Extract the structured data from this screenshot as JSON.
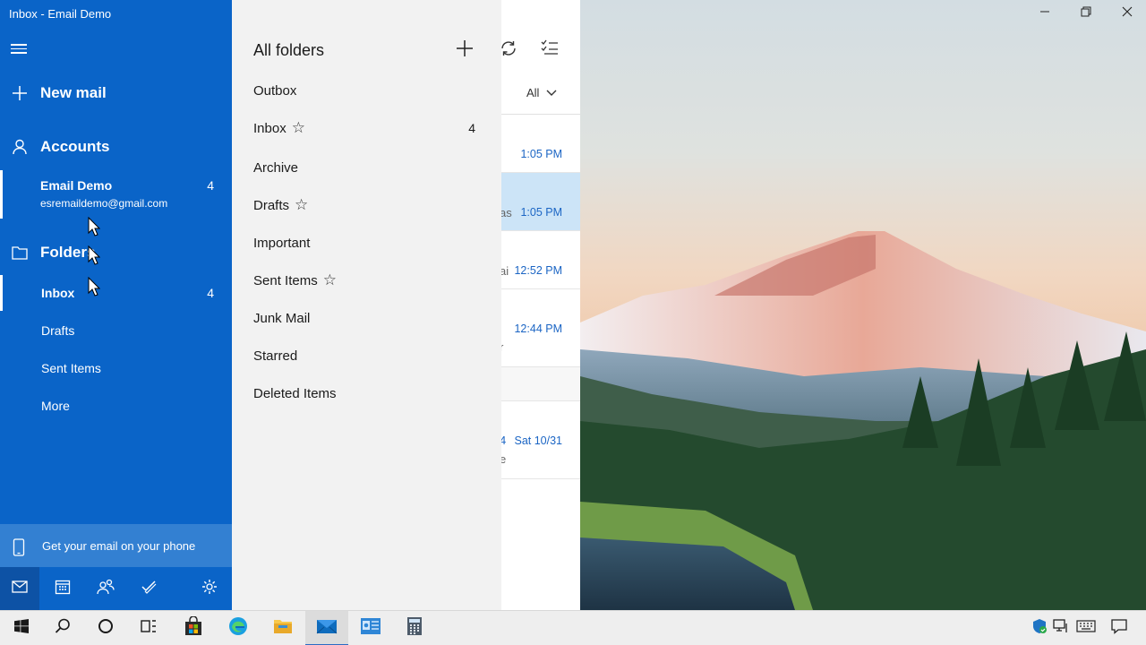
{
  "window": {
    "title": "Inbox - Email Demo"
  },
  "nav": {
    "new_mail": "New mail",
    "accounts": "Accounts",
    "account_name": "Email Demo",
    "account_email": "esremaildemo@gmail.com",
    "account_count": "4",
    "folders": "Folders",
    "items": [
      {
        "label": "Inbox",
        "count": "4"
      },
      {
        "label": "Drafts",
        "count": ""
      },
      {
        "label": "Sent Items",
        "count": ""
      },
      {
        "label": "More",
        "count": ""
      }
    ],
    "phone_promo": "Get your email on your phone",
    "bottom_icons": [
      "mail-icon",
      "calendar-icon",
      "people-icon",
      "todo-icon",
      "settings-icon"
    ]
  },
  "all_folders": {
    "title": "All folders",
    "items": [
      {
        "label": "Outbox",
        "starred": false,
        "count": ""
      },
      {
        "label": "Inbox",
        "starred": true,
        "count": "4"
      },
      {
        "label": "Archive",
        "starred": false,
        "count": ""
      },
      {
        "label": "Drafts",
        "starred": true,
        "count": ""
      },
      {
        "label": "Important",
        "starred": false,
        "count": ""
      },
      {
        "label": "Sent Items",
        "starred": true,
        "count": ""
      },
      {
        "label": "Junk Mail",
        "starred": false,
        "count": ""
      },
      {
        "label": "Starred",
        "starred": false,
        "count": ""
      },
      {
        "label": "Deleted Items",
        "starred": false,
        "count": ""
      }
    ]
  },
  "message_list": {
    "filter": "All",
    "messages": [
      {
        "time": "1:05 PM",
        "fragment": "",
        "selected": false
      },
      {
        "time": "1:05 PM",
        "fragment": "as",
        "selected": true
      },
      {
        "time": "12:52 PM",
        "fragment": "ai",
        "selected": false
      },
      {
        "time": "12:44 PM",
        "fragment": "r",
        "selected": false
      },
      {
        "time": "Sat 10/31",
        "fragment": "e",
        "selected": false
      }
    ]
  },
  "taskbar": {
    "apps": [
      "start-icon",
      "search-icon",
      "cortana-icon",
      "task-view-icon",
      "store-icon",
      "edge-icon",
      "file-explorer-icon",
      "mail-icon",
      "outlook-icon",
      "calculator-icon"
    ],
    "active_app": "mail-icon"
  },
  "colors": {
    "nav_bg": "#0a64c8",
    "accent": "#1b65c4",
    "flyout_bg": "#f2f2f2"
  }
}
